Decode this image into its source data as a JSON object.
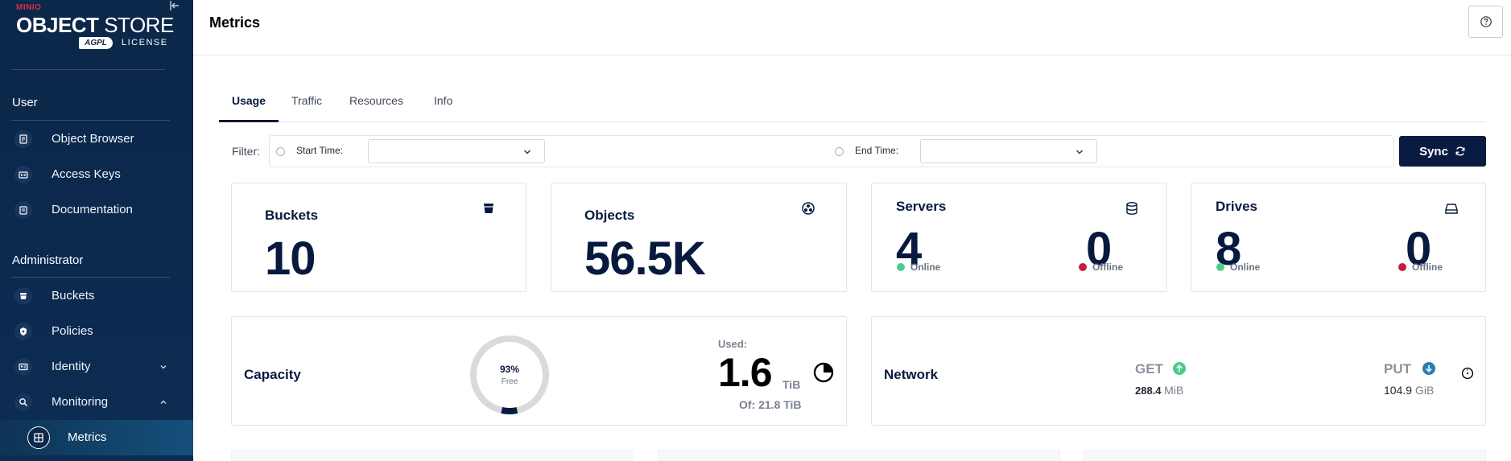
{
  "sidebar": {
    "logo": {
      "brand": "MINIO",
      "product_bold": "OBJECT",
      "product_light": "STORE",
      "badge": "AGPL",
      "license": "LICENSE"
    },
    "user_section": "User",
    "user_items": [
      {
        "label": "Object Browser",
        "icon": "object-browser-icon"
      },
      {
        "label": "Access Keys",
        "icon": "access-keys-icon"
      },
      {
        "label": "Documentation",
        "icon": "documentation-icon"
      }
    ],
    "admin_section": "Administrator",
    "admin_items": [
      {
        "label": "Buckets",
        "icon": "bucket-icon"
      },
      {
        "label": "Policies",
        "icon": "policy-icon"
      },
      {
        "label": "Identity",
        "icon": "identity-icon"
      },
      {
        "label": "Monitoring",
        "icon": "monitoring-icon"
      },
      {
        "label": "Metrics",
        "icon": "metrics-icon"
      }
    ]
  },
  "header": {
    "title": "Metrics"
  },
  "tabs": [
    "Usage",
    "Traffic",
    "Resources",
    "Info"
  ],
  "filter": {
    "label": "Filter:",
    "start_label": "Start Time:",
    "end_label": "End Time:",
    "start_value": "",
    "end_value": "",
    "sync_label": "Sync"
  },
  "cards": {
    "buckets": {
      "title": "Buckets",
      "value": "10"
    },
    "objects": {
      "title": "Objects",
      "value": "56.5K"
    },
    "servers": {
      "title": "Servers",
      "online": "4",
      "online_label": "Online",
      "offline": "0",
      "offline_label": "Offline"
    },
    "drives": {
      "title": "Drives",
      "online": "8",
      "online_label": "Online",
      "offline": "0",
      "offline_label": "Offline"
    },
    "capacity": {
      "title": "Capacity",
      "free_percent": "93%",
      "free_label": "Free",
      "free_fraction": 0.93,
      "used_label": "Used:",
      "used_value": "1.6",
      "used_unit": "TiB",
      "of_label": "Of: 21.8 TiB"
    },
    "network": {
      "title": "Network",
      "get_label": "GET",
      "get_value": "288.4",
      "get_unit": "MiB",
      "put_label": "PUT",
      "put_value": "104.9",
      "put_unit": "GiB"
    }
  },
  "colors": {
    "primary": "#081c42",
    "online": "#4ccb8d",
    "offline": "#c51b3d",
    "get": "#4ccb8d",
    "put": "#2781b0"
  }
}
